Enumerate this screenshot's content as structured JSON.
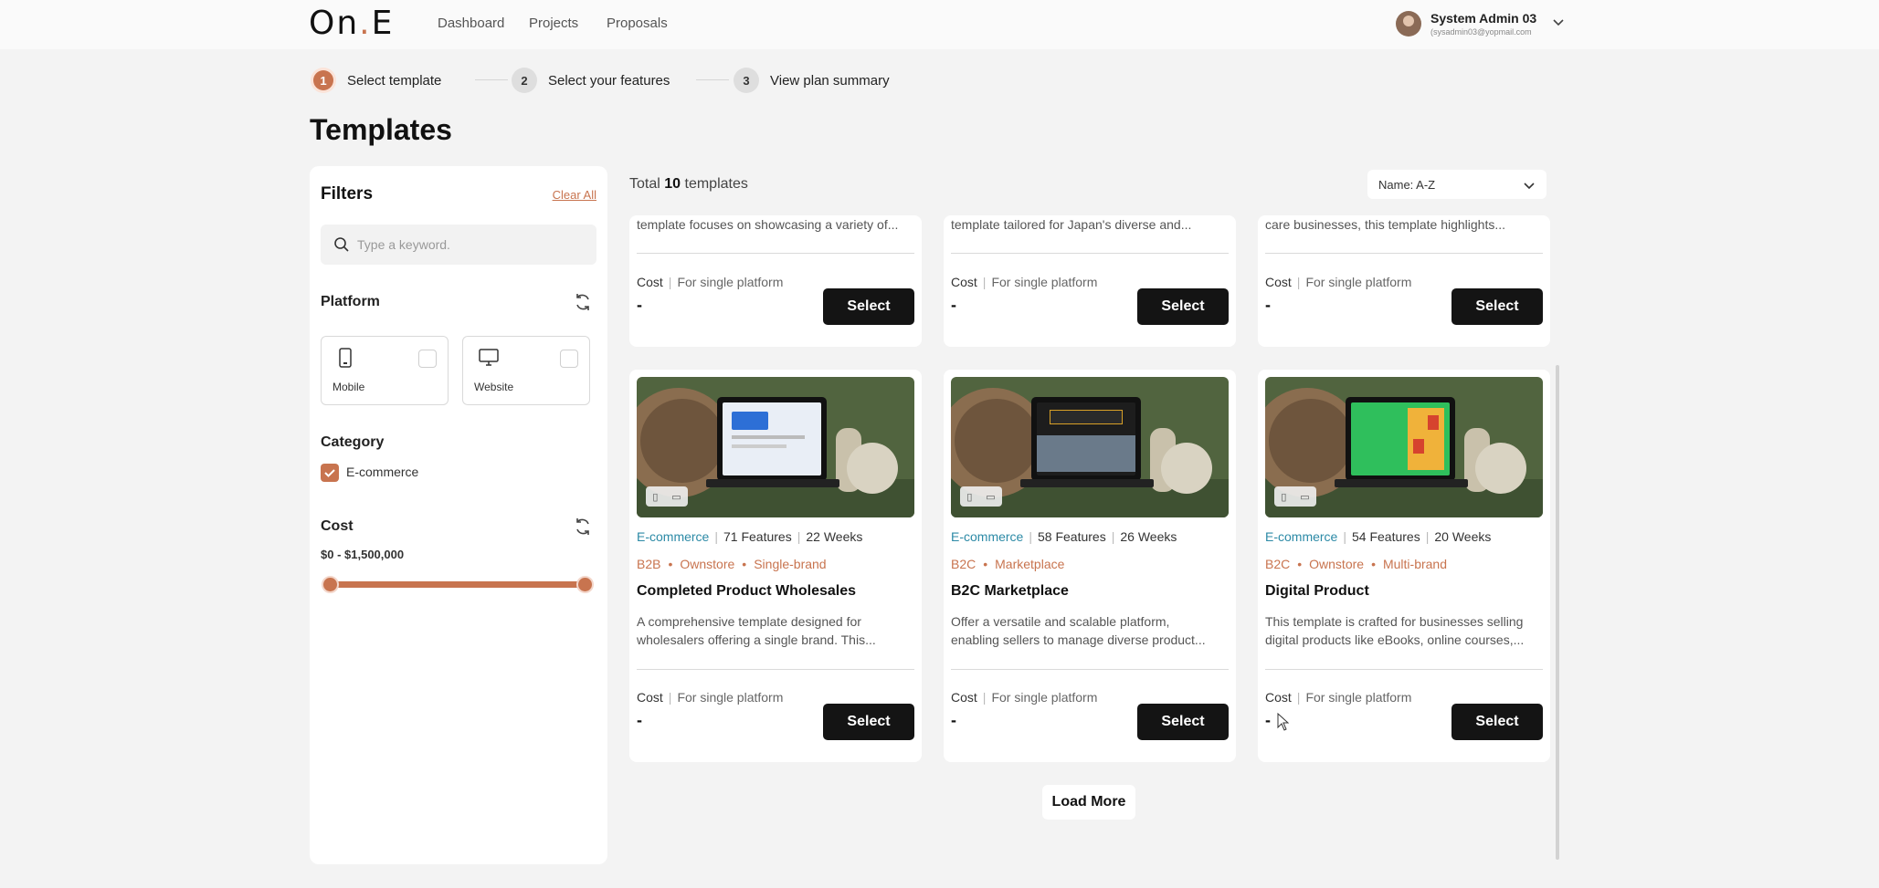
{
  "header": {
    "logo_prefix": "O",
    "logo_mid": "n",
    "logo_dot": ".",
    "logo_suffix": "E",
    "nav": [
      {
        "label": "Dashboard"
      },
      {
        "label": "Projects"
      },
      {
        "label": "Proposals"
      }
    ],
    "user": {
      "name": "System Admin 03",
      "email": "(sysadmin03@yopmail.com"
    }
  },
  "stepper": [
    {
      "num": "1",
      "label": "Select template",
      "active": true
    },
    {
      "num": "2",
      "label": "Select your features",
      "active": false
    },
    {
      "num": "3",
      "label": "View plan summary",
      "active": false
    }
  ],
  "page_title": "Templates",
  "filters": {
    "title": "Filters",
    "clear_label": "Clear All",
    "search_placeholder": "Type a keyword.",
    "platform_title": "Platform",
    "platforms": [
      {
        "label": "Mobile",
        "checked": false
      },
      {
        "label": "Website",
        "checked": false
      }
    ],
    "category_title": "Category",
    "categories": [
      {
        "label": "E-commerce",
        "checked": true
      }
    ],
    "cost_title": "Cost",
    "cost_range": "$0 - $1,500,000",
    "slider": {
      "min_fraction": 0,
      "max_fraction": 1
    }
  },
  "results": {
    "total_prefix": "Total",
    "total_count": "10",
    "total_suffix": "templates",
    "sort_value": "Name: A-Z"
  },
  "top_cards": [
    {
      "desc": "template focuses on showcasing a variety of...",
      "cost_label": "Cost",
      "cost_sub": "For single platform",
      "cost_value": "-",
      "select": "Select"
    },
    {
      "desc": "template tailored for Japan's diverse and...",
      "cost_label": "Cost",
      "cost_sub": "For single platform",
      "cost_value": "-",
      "select": "Select"
    },
    {
      "desc": "care businesses, this template highlights...",
      "cost_label": "Cost",
      "cost_sub": "For single platform",
      "cost_value": "-",
      "select": "Select"
    }
  ],
  "cards": [
    {
      "category": "E-commerce",
      "features": "71 Features",
      "weeks": "22 Weeks",
      "tags": [
        "B2B",
        "Ownstore",
        "Single-brand"
      ],
      "name": "Completed Product Wholesales",
      "desc1": "A comprehensive template designed for",
      "desc2": "wholesalers offering a single brand. This...",
      "cost_label": "Cost",
      "cost_sub": "For single platform",
      "cost_value": "-",
      "select": "Select",
      "screen_color": "#e9eef6"
    },
    {
      "category": "E-commerce",
      "features": "58 Features",
      "weeks": "26 Weeks",
      "tags": [
        "B2C",
        "Marketplace"
      ],
      "name": "B2C Marketplace",
      "desc1": "Offer a versatile and scalable platform,",
      "desc2": "enabling sellers to manage diverse product...",
      "cost_label": "Cost",
      "cost_sub": "For single platform",
      "cost_value": "-",
      "select": "Select",
      "screen_color": "#1d1d1d"
    },
    {
      "category": "E-commerce",
      "features": "54 Features",
      "weeks": "20 Weeks",
      "tags": [
        "B2C",
        "Ownstore",
        "Multi-brand"
      ],
      "name": "Digital Product",
      "desc1": "This template is crafted for businesses selling",
      "desc2": "digital products like eBooks, online courses,...",
      "cost_label": "Cost",
      "cost_sub": "For single platform",
      "cost_value": "-",
      "select": "Select",
      "screen_color": "#2fbf5c"
    }
  ],
  "load_more": "Load More",
  "colors": {
    "accent": "#c8744f",
    "category": "#2c8aa6",
    "button": "#141414"
  }
}
